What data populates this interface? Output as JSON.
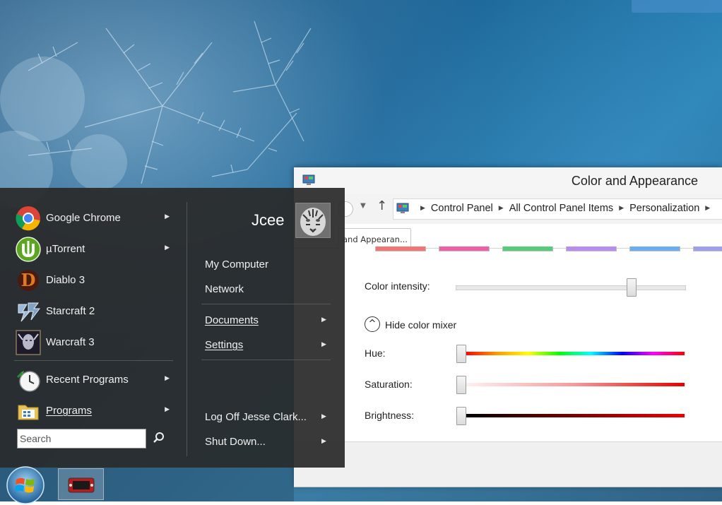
{
  "window": {
    "title": "Color and Appearance",
    "breadcrumbs": [
      "Control Panel",
      "All Control Panel Items",
      "Personalization"
    ],
    "tab_label": "and Appearan...",
    "swatch_colors": [
      "#f27474",
      "#ef5fa5",
      "#55cc77",
      "#b88cf0",
      "#6aaef0",
      "#9f9ff0"
    ],
    "color_intensity": {
      "label": "Color intensity:",
      "value": 0.78
    },
    "mixer_toggle_label": "Hide color mixer",
    "hue": {
      "label": "Hue:",
      "value": 0.0
    },
    "saturation": {
      "label": "Saturation:",
      "value": 0.0
    },
    "brightness": {
      "label": "Brightness:",
      "value": 0.0
    }
  },
  "start_menu": {
    "user_name": "Jcee",
    "pinned": [
      {
        "label": "Google Chrome",
        "icon": "chrome-icon",
        "has_submenu": true
      },
      {
        "label": "µTorrent",
        "icon": "utorrent-icon",
        "has_submenu": true
      },
      {
        "label": "Diablo 3",
        "icon": "diablo-icon",
        "has_submenu": false
      },
      {
        "label": "Starcraft 2",
        "icon": "starcraft-icon",
        "has_submenu": false
      },
      {
        "label": "Warcraft 3",
        "icon": "warcraft-icon",
        "has_submenu": false
      }
    ],
    "recent_programs": "Recent Programs",
    "programs": "Programs",
    "search_placeholder": "Search",
    "right_items": {
      "my_computer": "My Computer",
      "network": "Network",
      "documents": "Documents",
      "settings": "Settings",
      "log_off": "Log Off Jesse Clark...",
      "shut_down": "Shut Down..."
    }
  }
}
